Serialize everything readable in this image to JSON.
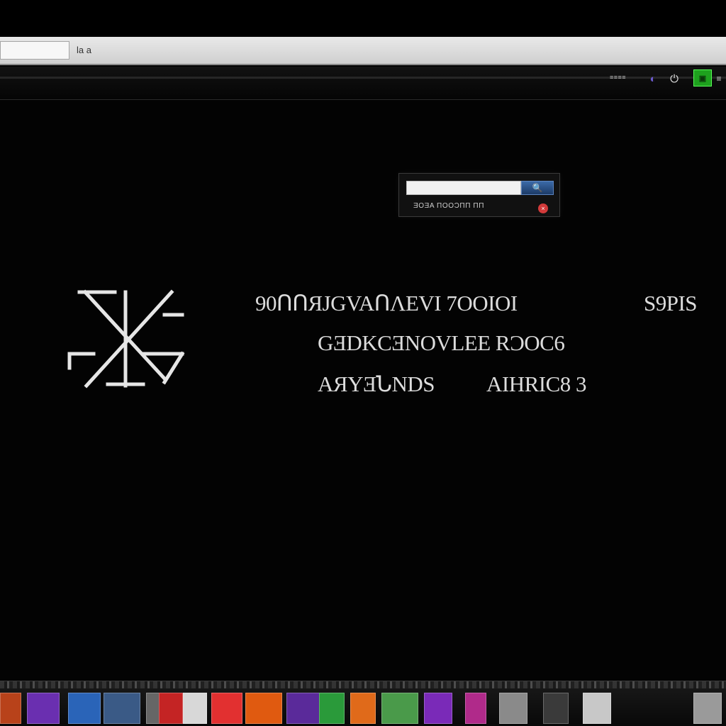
{
  "browser": {
    "address_field": "",
    "address_text": "la a",
    "toolbar_label": "≡≡≡≡"
  },
  "search": {
    "placeholder": "",
    "meta": "ƎOƎA ΠОOƆΠΠ ΠΠ",
    "button_glyph": "🔍",
    "close_glyph": "×"
  },
  "splash": {
    "line1": "90ՈՈЯЈGVAՈΛEVI 7OOIOI",
    "line1b": "S9PIS",
    "line2": "GƎDKCƎNOVLEE RƆOC6",
    "line3": "AЯYƎՆNDS",
    "line3b": "AIHRIC8 3"
  },
  "taskbar": {
    "icons": [
      {
        "name": "app-orange",
        "color": "#b8421a"
      },
      {
        "name": "app-purple",
        "color": "#6a2fb0"
      },
      {
        "name": "app-blue",
        "color": "#2a64b8"
      },
      {
        "name": "app-photo",
        "color": "#3a5a86"
      },
      {
        "name": "app-gray",
        "color": "#666666"
      },
      {
        "name": "app-red-doc",
        "color": "#c42424"
      },
      {
        "name": "app-grid",
        "color": "#d8d8d8"
      },
      {
        "name": "app-red",
        "color": "#e23030"
      },
      {
        "name": "app-multicolor",
        "color": "#e05a10"
      },
      {
        "name": "app-violet",
        "color": "#5a2a9a"
      },
      {
        "name": "app-green",
        "color": "#2a9a3a"
      },
      {
        "name": "app-orange-bar",
        "color": "#e06a1a"
      },
      {
        "name": "app-colorful",
        "color": "#4a9a4a"
      },
      {
        "name": "app-purple-2",
        "color": "#7a2ab8"
      },
      {
        "name": "app-pink",
        "color": "#b02a8a"
      },
      {
        "name": "app-camera",
        "color": "#8a8a8a"
      },
      {
        "name": "app-disc",
        "color": "#3a3a3a"
      },
      {
        "name": "app-preview",
        "color": "#c8c8c8"
      },
      {
        "name": "app-trash",
        "color": "#9a9a9a"
      }
    ]
  },
  "colors": {
    "background": "#030303",
    "text": "#dcdcdc",
    "accent_green": "#1ea11e"
  }
}
